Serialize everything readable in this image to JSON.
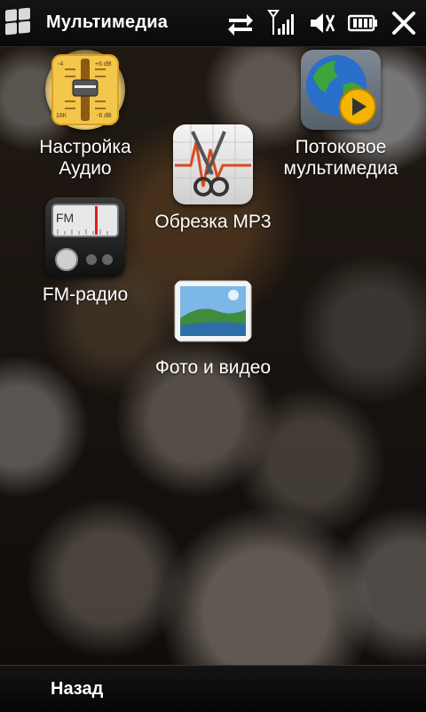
{
  "header": {
    "title": "Мультимедиа",
    "icons": [
      "windows-start-icon",
      "data-sync-icon",
      "signal-icon",
      "speaker-muted-icon",
      "battery-icon",
      "close-icon"
    ]
  },
  "apps": [
    {
      "label": "Настройка\nАудио",
      "icon": "audio-settings-icon"
    },
    {
      "label": "Потоковое\nмультимедиа",
      "icon": "streaming-media-icon"
    },
    {
      "label": "Обрезка MP3",
      "icon": "mp3-trimmer-icon"
    },
    {
      "label": "FM-радио",
      "icon": "fm-radio-icon"
    },
    {
      "label": "Фото и видео",
      "icon": "photos-videos-icon"
    }
  ],
  "audio_icon_labels": {
    "minus4": "-4",
    "plus6db": "+6 dB",
    "k16": "16K",
    "minus6db": "-6 dB"
  },
  "fm_icon_label": "FM",
  "footer": {
    "back_label": "Назад"
  },
  "colors": {
    "bar_bg": "#111111",
    "text": "#ffffff"
  }
}
